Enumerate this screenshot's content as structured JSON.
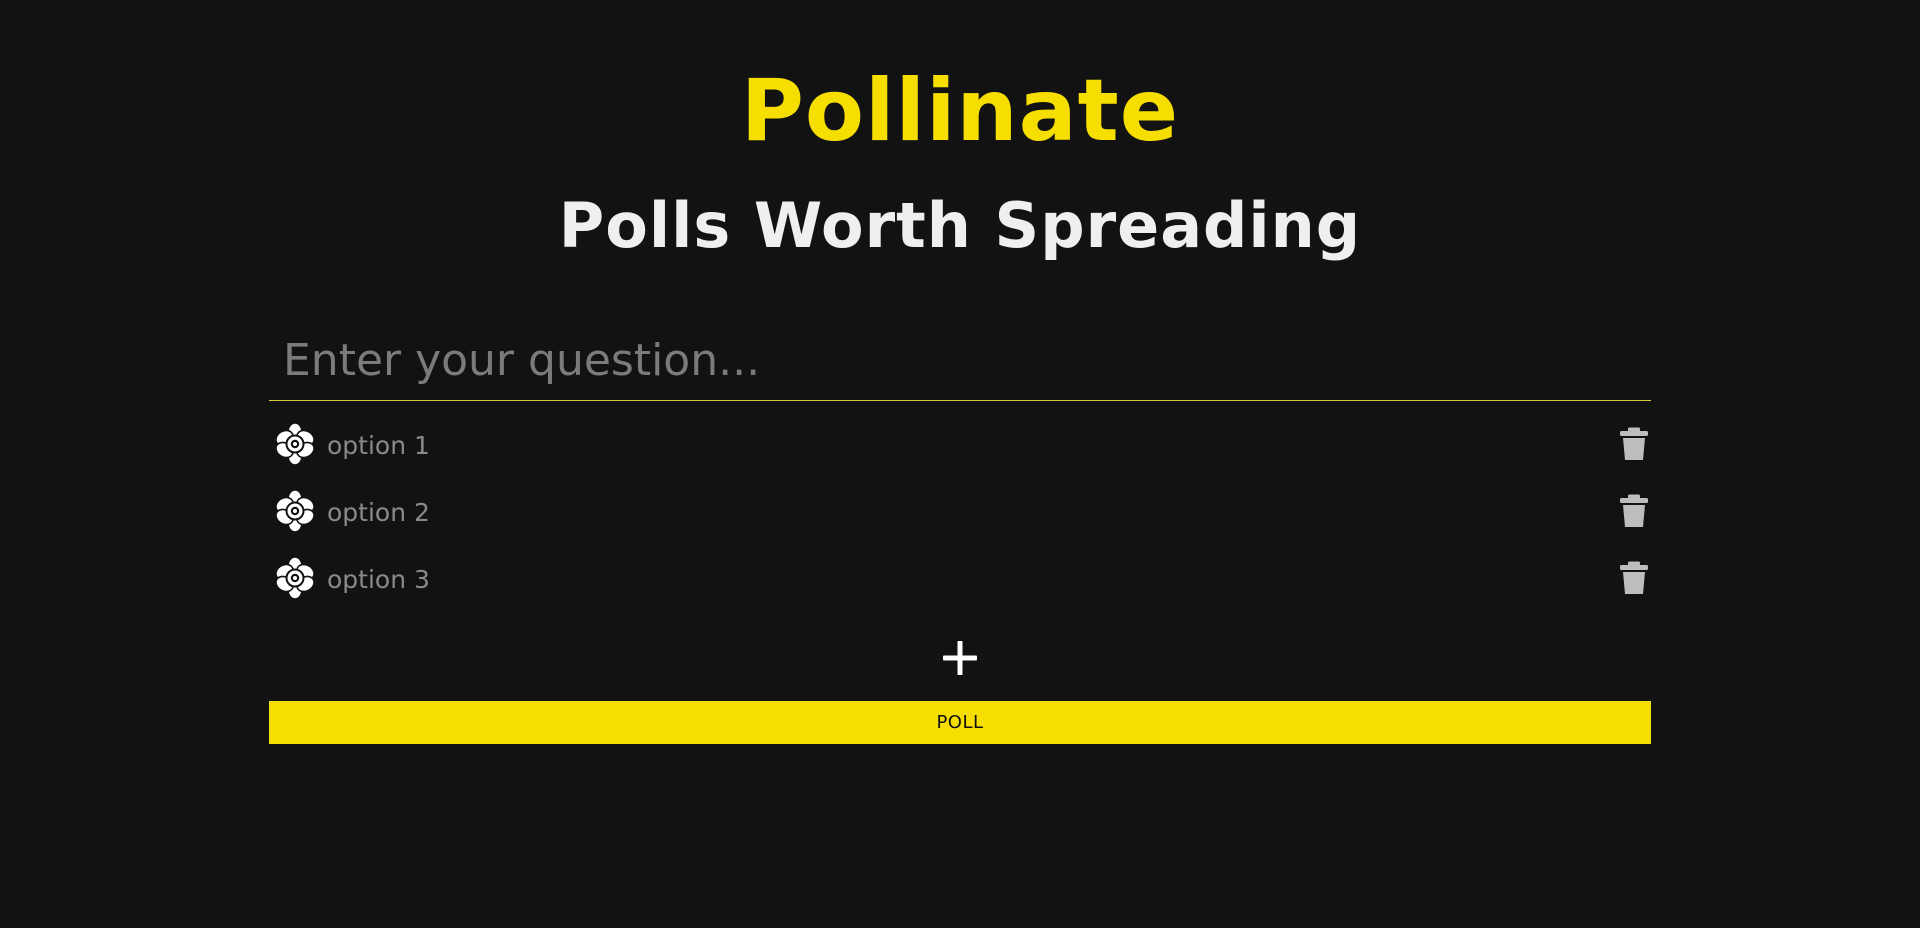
{
  "header": {
    "title": "Pollinate",
    "subtitle": "Polls Worth Spreading"
  },
  "form": {
    "question_placeholder": "Enter your question...",
    "question_value": "",
    "options": [
      {
        "placeholder": "option 1",
        "value": "",
        "icon": "flower-icon",
        "delete_icon": "trash-icon"
      },
      {
        "placeholder": "option 2",
        "value": "",
        "icon": "flower-icon",
        "delete_icon": "trash-icon"
      },
      {
        "placeholder": "option 3",
        "value": "",
        "icon": "flower-icon",
        "delete_icon": "trash-icon"
      }
    ],
    "add_icon": "plus-icon",
    "submit_label": "POLL"
  },
  "colors": {
    "background": "#121212",
    "accent": "#f6df00",
    "subtitle": "#efefef",
    "underline": "#d7c53c",
    "placeholder": "#7b7b7b",
    "trash": "#bdbdbd"
  }
}
